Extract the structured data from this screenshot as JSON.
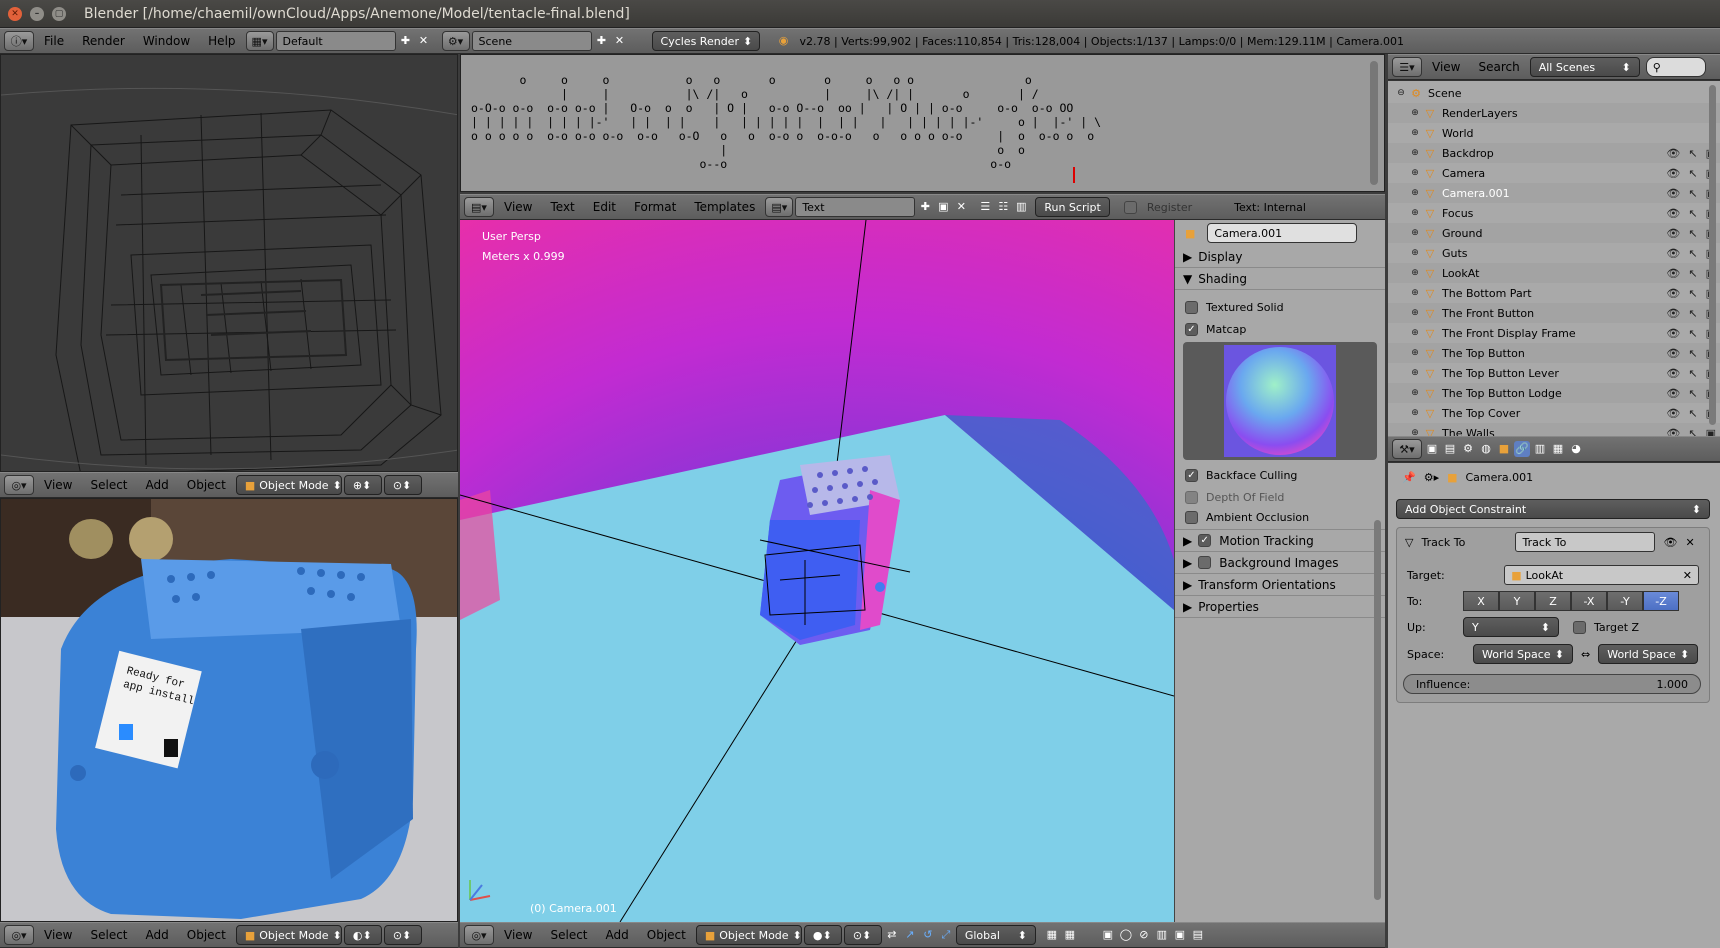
{
  "window": {
    "title": "Blender [/home/chaemil/ownCloud/Apps/Anemone/Model/tentacle-final.blend]"
  },
  "info_header": {
    "menus": [
      "File",
      "Render",
      "Window",
      "Help"
    ],
    "layout": "Default",
    "scene": "Scene",
    "engine": "Cycles Render",
    "stats": "v2.78 | Verts:99,902 | Faces:110,854 | Tris:128,004 | Objects:1/137 | Lamps:0/0 | Mem:129.11M | Camera.001"
  },
  "text_editor": {
    "ascii_lines": [
      "       o     o     o           o   o       o       o     o   o o                o",
      "             |     |           |\\ /|   o           |     |\\ /| |       o       | /",
      "o-O-o o-o  o-o o-o |   O-o  o  o   | O |   o-o O--o  oo |   | O | | o-o     o-o  o-o OO",
      "| | | | |  | | | |-'   | |  | |    |   | | | | |  |  | |   |   | | | | |-'     o |  |-' | \\",
      "o o o o o  o-o o-o o-o  o-o   o-O   o   o  o-o o  o-o-o   o   o o o o-o     |  o  o-o o  o",
      "                                    |                                       o  o",
      "                                 o--o                                      o-o"
    ],
    "menus": [
      "View",
      "Text",
      "Edit",
      "Format",
      "Templates"
    ],
    "text_name": "Text",
    "run_script": "Run Script",
    "register": "Register",
    "text_internal": "Text: Internal"
  },
  "viewport_main": {
    "label": "User Persp",
    "units": "Meters x 0.999",
    "object_label": "(0) Camera.001",
    "menus": [
      "View",
      "Select",
      "Add",
      "Object"
    ],
    "mode": "Object Mode",
    "orientation": "Global"
  },
  "viewport_wire": {
    "menus": [
      "View",
      "Select",
      "Add",
      "Object"
    ],
    "mode": "Object Mode"
  },
  "viewport_render": {
    "menus": [
      "View",
      "Select",
      "Add",
      "Object"
    ],
    "mode": "Object Mode",
    "screen_text": "Ready for app install"
  },
  "properties_shelf": {
    "object_name": "Camera.001",
    "display": "Display",
    "shading": "Shading",
    "textured_solid": "Textured Solid",
    "matcap": "Matcap",
    "backface_culling": "Backface Culling",
    "depth_of_field": "Depth Of Field",
    "ambient_occlusion": "Ambient Occlusion",
    "motion_tracking": "Motion Tracking",
    "background_images": "Background Images",
    "transform_orientations": "Transform Orientations",
    "properties": "Properties"
  },
  "outliner": {
    "menus": [
      "View",
      "Search"
    ],
    "filter": "All Scenes",
    "items": [
      {
        "name": "Scene",
        "indent": 0
      },
      {
        "name": "RenderLayers",
        "indent": 1
      },
      {
        "name": "World",
        "indent": 1
      },
      {
        "name": "Backdrop",
        "indent": 1
      },
      {
        "name": "Camera",
        "indent": 1
      },
      {
        "name": "Camera.001",
        "indent": 1
      },
      {
        "name": "Focus",
        "indent": 1
      },
      {
        "name": "Ground",
        "indent": 1
      },
      {
        "name": "Guts",
        "indent": 1
      },
      {
        "name": "LookAt",
        "indent": 1
      },
      {
        "name": "The Bottom Part",
        "indent": 1
      },
      {
        "name": "The Front Button",
        "indent": 1
      },
      {
        "name": "The Front Display Frame",
        "indent": 1
      },
      {
        "name": "The Top Button",
        "indent": 1
      },
      {
        "name": "The Top Button Lever",
        "indent": 1
      },
      {
        "name": "The Top Button Lodge",
        "indent": 1
      },
      {
        "name": "The Top Cover",
        "indent": 1
      },
      {
        "name": "The Walls",
        "indent": 1
      }
    ]
  },
  "constraints": {
    "object_name": "Camera.001",
    "add_constraint": "Add Object Constraint",
    "constraint_type": "Track To",
    "constraint_name": "Track To",
    "target_label": "Target:",
    "target_value": "LookAt",
    "to_label": "To:",
    "axes": [
      "X",
      "Y",
      "Z",
      "-X",
      "-Y",
      "-Z"
    ],
    "selected_axis": "-Z",
    "up_label": "Up:",
    "up_value": "Y",
    "target_z": "Target Z",
    "space_label": "Space:",
    "owner_space": "World Space",
    "target_space": "World Space",
    "influence_label": "Influence:",
    "influence_value": "1.000"
  }
}
